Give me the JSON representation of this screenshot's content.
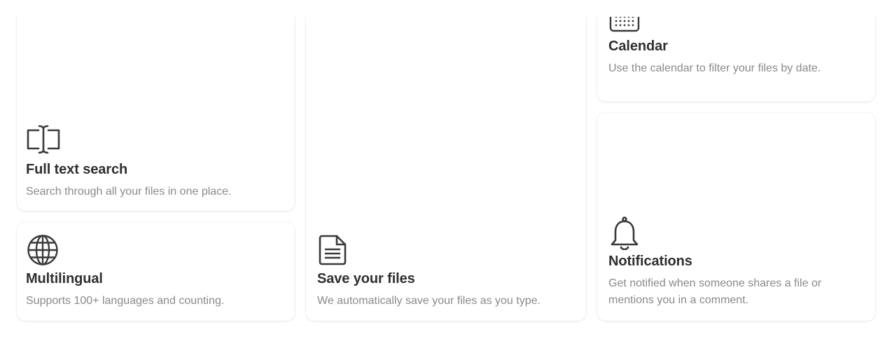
{
  "features": {
    "full_text_search": {
      "icon": "text-cursor-icon",
      "title": "Full text search",
      "description": "Search through all your files in one place."
    },
    "multilingual": {
      "icon": "globe-icon",
      "title": "Multilingual",
      "description": "Supports 100+ languages and counting."
    },
    "save_files": {
      "icon": "document-icon",
      "title": "Save your files",
      "description": "We automatically save your files as you type."
    },
    "calendar": {
      "icon": "calendar-icon",
      "title": "Calendar",
      "description": "Use the calendar to filter your files by date."
    },
    "notifications": {
      "icon": "bell-icon",
      "title": "Notifications",
      "description": "Get notified when someone shares a file or mentions you in a comment."
    }
  },
  "colors": {
    "title": "#2f2f2f",
    "description": "#8a8a8a",
    "icon_stroke": "#3a3a3a",
    "card_background": "#ffffff"
  }
}
